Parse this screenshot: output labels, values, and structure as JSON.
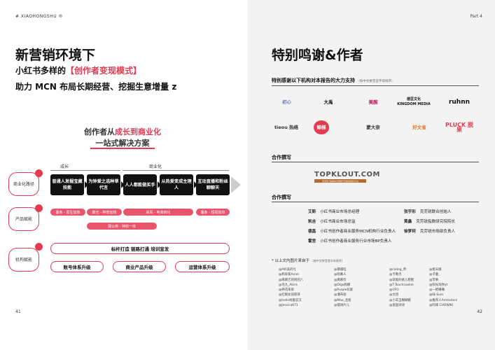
{
  "header": {
    "brand": "# XIAOHONGSHU ®",
    "part": "Part 4"
  },
  "left": {
    "title": "新营销环境下",
    "subtitle_prefix": "小红书多样的",
    "subtitle_accent": "【创作者变现模式】",
    "subtitle2": "助力 MCN 布局长期经营、挖掘生意增量 z",
    "center_title_prefix": "创作者从",
    "center_title_accent": "成长到商业化",
    "center_title_line2": "一站式解决方案",
    "arrow_growth": "成长",
    "arrow_commerce": "商业化",
    "rows": {
      "biz_path": "商业化路径",
      "product": "产品赋能",
      "mcn": "机构赋能"
    },
    "stages": [
      "普通人发掘宝藏技能",
      "为钟爱之选种草代言",
      "人人都能做买手",
      "从热爱变成主理人",
      "互动直播和粉丝聊聊天"
    ],
    "pills": [
      "薯条 - 原生加热",
      "聚光 - 种草加热",
      "来风 - 电商转化",
      "薯条 - 短视加热",
      "蒲公英 - 种收一体"
    ],
    "ops_top": "标杆打造  链路打通  培训宣发",
    "ops_bottom": [
      "账号体系升级",
      "商业产品升级",
      "运营体系升级"
    ],
    "page_number": "41"
  },
  "right": {
    "title": "特别鸣谢&作者",
    "thanks_heading": "特别感谢以下机构对本报告的大力支持",
    "thanks_note": "（按中文拼音首字母排序）",
    "logos": [
      "初心",
      "大禹",
      "美腕",
      "德豆文化 KINGDOM MEDIA",
      "ruhnn",
      "tieou 热络",
      "鲸梯",
      "蒙大奈",
      "好文雀",
      "PLUCK 脱果"
    ],
    "writing_heading": "合作撰写",
    "writing_logo": "TOPKLOUT.COM",
    "writing_logo_sub": "克劳锐·自媒体价值排行及版权经纪平台",
    "authors_heading": "合作撰写",
    "authors": [
      {
        "name": "艾斯",
        "role": "小红书商业市场总经理"
      },
      {
        "name": "张宇形",
        "role": "克劳锐联合创始人"
      },
      {
        "name": "凯吉",
        "role": "小红书商业市场总监"
      },
      {
        "name": "黄鑫",
        "role": "克劳锐指数研究院院长"
      },
      {
        "name": "德昌",
        "role": "小红书创作者商业服务MCN机构行业负责人"
      },
      {
        "name": "徐梦珂",
        "role": "克劳锐市场部负责人"
      },
      {
        "name": "霍宫",
        "role": "小红书创作者商业服务行业市场BP负责人"
      }
    ],
    "image_note": "* 以上文内图片来自于",
    "image_note_small": "（按中文拼音首字母排序）",
    "credits": [
      "@AKI美的YJ",
      "@暴躁哇",
      "@caling_草",
      "@桃天娘",
      "@和泉家Amei",
      "@暗幕人",
      "@卡勒杰",
      "@子童_",
      "@麻麻吉的阿团八",
      "@麻麻奈",
      "@就能的桃儿鞋鞋",
      "@李栗",
      "@毛九_Akira",
      "@Olga和娜",
      "@T-Touchcookie",
      "@阳光淘你yt",
      "@养花家家",
      "@Purple有紫",
      "@UFO",
      "@一把嘴嘴",
      "@红眼女孩郁芽",
      "@潘布丽",
      "@文团",
      "@味-Sum",
      "@hello地着说汉",
      "@Max_北程",
      "@小羊当糊糊酱",
      "@推荐人Ammoteni",
      "@Jessica671",
      "@摆球片儿",
      "@爱国诗诗",
      "@阿锋 CHOWIKI"
    ],
    "page_number": "42"
  }
}
